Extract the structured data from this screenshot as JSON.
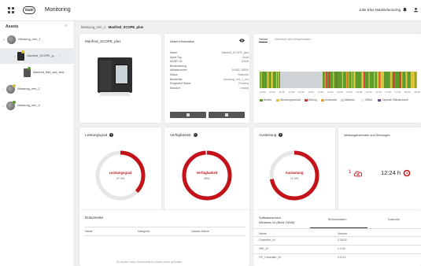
{
  "header": {
    "logo_text": "Stahl",
    "app_title": "Monitoring",
    "company": "Jolle Else Maskinfacturing",
    "icons": [
      "grid-icon",
      "bell-icon",
      "user-icon"
    ]
  },
  "sidebar": {
    "title": "Assets",
    "items": [
      {
        "label": "Messung_nrm_1"
      },
      {
        "label": "Manfred_SCOPE_p..."
      },
      {
        "label": "Manfred_Bild_abc_test..."
      },
      {
        "label": "Messung_nrm_2"
      },
      {
        "label": "Messung_nrm_3"
      }
    ]
  },
  "breadcrumb": {
    "path": "Messung_nrm_1 › ",
    "current": "Manfred_SCOPE_plus"
  },
  "device_card": {
    "title": "Manfred_SCOPE_plus"
  },
  "asset_info": {
    "title": "Asset Information",
    "rows": [
      {
        "k": "Name",
        "v": "Manfred_SCOPE_plus"
      },
      {
        "k": "Asset Typ",
        "v": "Gerät"
      },
      {
        "k": "ASSET-ID",
        "v": "10345"
      },
      {
        "k": "Beschreibung",
        "v": "-"
      },
      {
        "k": "Artikelnummer",
        "v": "D4482_28900"
      },
      {
        "k": "Status",
        "v": "Stationär"
      },
      {
        "k": "Bearbeiter",
        "v": "messung_nrm_1_ma"
      },
      {
        "k": "Eingesetzt Status",
        "v": "Running"
      },
      {
        "k": "Standort",
        "v": "Leipzig"
      }
    ]
  },
  "timeline": {
    "tabs": [
      "Verlauf",
      "Übersicht aller Ereignisdaten"
    ],
    "axis_labels": [
      "10:30",
      "11:00",
      "11:30",
      "12:00",
      "12:30",
      "13:00",
      "13:30",
      "14:00",
      "14:30",
      "15:00",
      "15:30",
      "16:00",
      "16:30",
      "17:00",
      "17:30",
      "18:00",
      "18:30"
    ],
    "legend": [
      {
        "label": "Betrieb",
        "color": "#5b9b2b"
      },
      {
        "label": "Werkzeugwechsel",
        "color": "#d9c43a"
      },
      {
        "label": "Störung",
        "color": "#d13a2e"
      },
      {
        "label": "Unbekannt",
        "color": "#f0a030"
      },
      {
        "label": "Stillstand",
        "color": "#cfd3d6"
      },
      {
        "label": "Offline",
        "color": "#e8e8e8"
      },
      {
        "label": "Geplante Stillstandszeit",
        "color": "#6f5080"
      }
    ]
  },
  "kpis": [
    {
      "title": "Leistungsgrad",
      "gauge_label": "Leistungsgrad",
      "value": "37.3%",
      "fraction": 0.373
    },
    {
      "title": "Verfügbarkeit",
      "gauge_label": "Verfügbarkeit",
      "value": "99%",
      "fraction": 0.99
    },
    {
      "title": "Auslastung",
      "gauge_label": "Auslastung",
      "value": "72.3%",
      "fraction": 0.723
    }
  ],
  "wait_card": {
    "title": "Wartungsintervalle und Störungen",
    "count": "1",
    "duration": "12:24 h",
    "icons": [
      "cloud-alert-icon",
      "clock-alert-icon"
    ]
  },
  "documents": {
    "title": "Dokumente",
    "columns": [
      "Name",
      "Kategorie",
      "Upload-Datum"
    ],
    "empty": "Es wurden keine Dokumente für dieses Asset gefunden"
  },
  "software": {
    "title": "Softwareversion",
    "subtitle": "Windows 10 (Build 19045)",
    "tabs": [
      "Betriebsdaten",
      "Kalender"
    ],
    "columns": [
      "Name",
      "Version"
    ],
    "rows": [
      {
        "name": "Controller_v1",
        "version": "2.18.02"
      },
      {
        "name": "HMI_v2",
        "version": "1.4.00"
      },
      {
        "name": "ITF_Controller_v3",
        "version": "4.0.0.1"
      }
    ]
  }
}
